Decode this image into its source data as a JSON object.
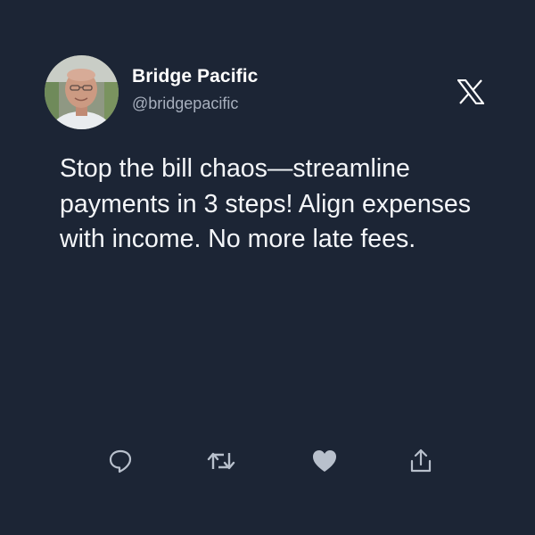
{
  "profile": {
    "name": "Bridge Pacific",
    "handle": "@bridgepacific",
    "avatar": "profile-photo"
  },
  "brand_icon": "x-logo-icon",
  "tweet": {
    "text": "Stop the bill chaos—streamline payments in 3 steps! Align expenses with income. No more late fees."
  },
  "actions": [
    {
      "name": "reply",
      "icon": "comment-icon"
    },
    {
      "name": "retweet",
      "icon": "retweet-icon"
    },
    {
      "name": "like",
      "icon": "heart-icon"
    },
    {
      "name": "share",
      "icon": "share-icon"
    }
  ],
  "colors": {
    "background": "#1c2535",
    "text": "#f4f6f9",
    "secondary_text": "#a7afbd",
    "icon": "#b8c0cc"
  }
}
